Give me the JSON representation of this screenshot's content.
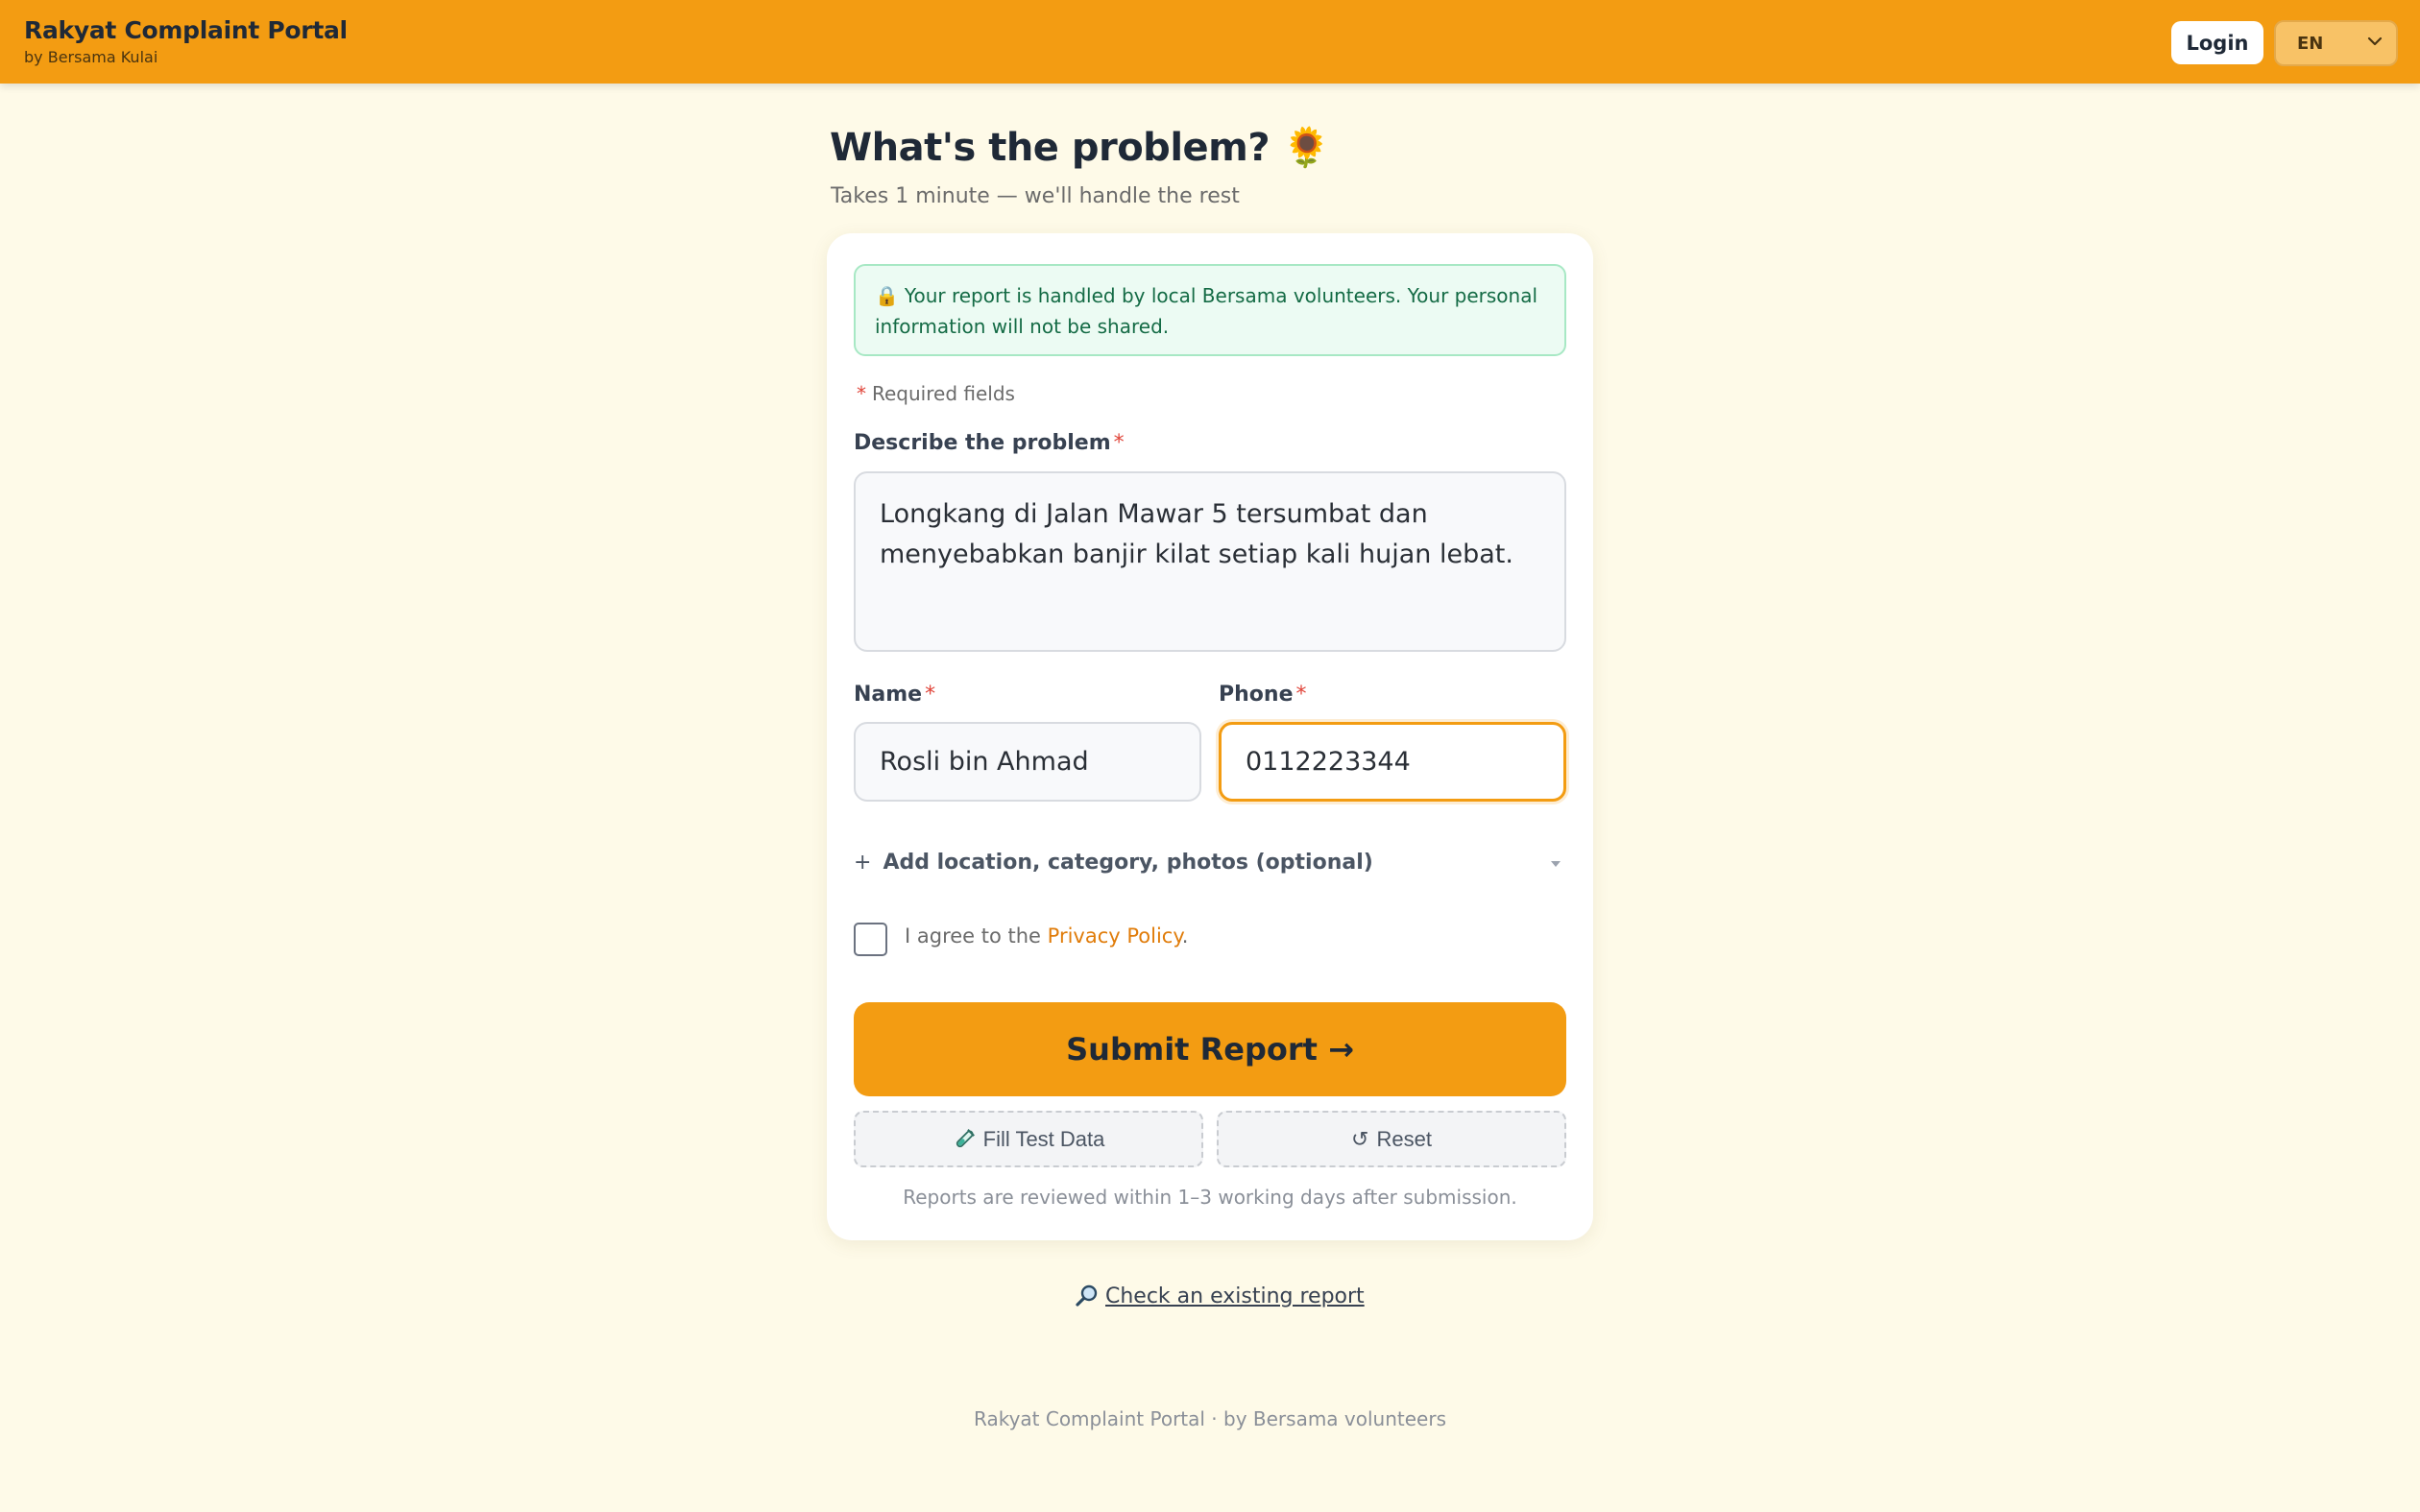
{
  "header": {
    "title": "Rakyat Complaint Portal",
    "subtitle": "by Bersama Kulai",
    "login_label": "Login",
    "language": "EN"
  },
  "page": {
    "title": "What's the problem? 🌻",
    "subtitle": "Takes 1 minute — we'll handle the rest"
  },
  "form": {
    "notice_icon": "lock-icon",
    "notice_text": "Your report is handled by local Bersama volunteers. Your personal information will not be shared.",
    "required_star": "*",
    "required_note": "Required fields",
    "problem_label": "Describe the problem",
    "problem_value": "Longkang di Jalan Mawar 5 tersumbat dan menyebabkan banjir kilat setiap kali hujan lebat.",
    "name_label": "Name",
    "name_value": "Rosli bin Ahmad",
    "phone_label": "Phone",
    "phone_value": "0112223344",
    "optional_plus": "+",
    "optional_label": "Add location, category, photos (optional)",
    "agree_prefix": "I agree to the",
    "privacy_link": "Privacy Policy",
    "agree_suffix": ".",
    "agree_checked": false,
    "submit_label": "Submit Report →",
    "fill_test_label": "Fill Test Data",
    "reset_icon": "↺",
    "reset_label": "Reset",
    "review_note": "Reports are reviewed within 1–3 working days after submission."
  },
  "links": {
    "check_existing": "Check an existing report"
  },
  "footer": {
    "text": "Rakyat Complaint Portal · by Bersama volunteers"
  },
  "colors": {
    "accent": "#f39c12",
    "background": "#fefae8",
    "notice_bg": "#ecfbf3",
    "notice_text": "#146b45",
    "required": "#e0453a",
    "link": "#e07c0a"
  }
}
